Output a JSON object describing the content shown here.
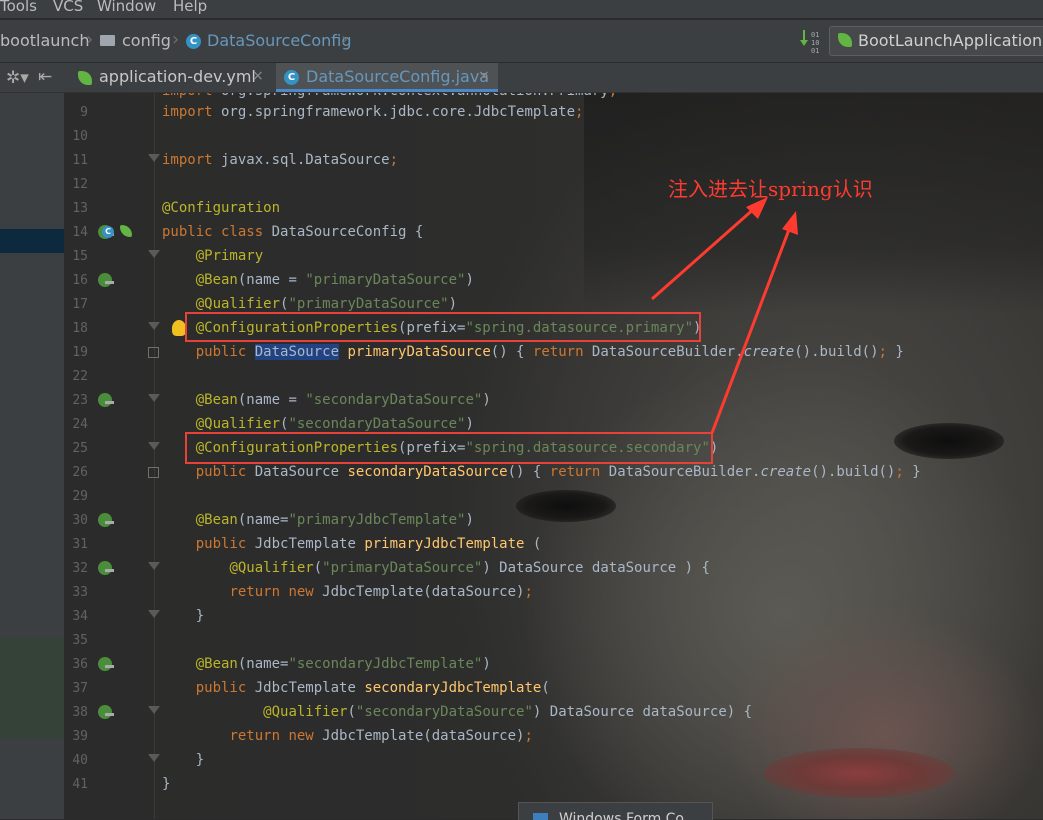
{
  "menu": [
    "Tools",
    "VCS",
    "Window",
    "Help"
  ],
  "breadcrumb": [
    "bootlaunch",
    "config",
    "DataSourceConfig"
  ],
  "run_config": "BootLaunchApplication",
  "tabs": [
    {
      "label": "application-dev.yml",
      "close": "×",
      "active": false
    },
    {
      "label": "DataSourceConfig.java",
      "close": "×",
      "active": true
    }
  ],
  "annotation": {
    "text": "注入进去让spring认识",
    "color": "#ff3b30"
  },
  "line_numbers": [
    "9",
    "10",
    "11",
    "12",
    "13",
    "14",
    "15",
    "16",
    "17",
    "18",
    "19",
    "22",
    "23",
    "24",
    "25",
    "26",
    "29",
    "30",
    "31",
    "32",
    "33",
    "34",
    "35",
    "36",
    "37",
    "38",
    "39",
    "40",
    "41"
  ],
  "popup": {
    "text": "Windows Form Co"
  },
  "colors": {
    "editor_bg": "#2b2b2b",
    "keyword": "#cc7832",
    "annotation": "#bbb529",
    "string": "#6a8759",
    "method": "#ffc66d",
    "highlight_box": "#e8413a"
  }
}
